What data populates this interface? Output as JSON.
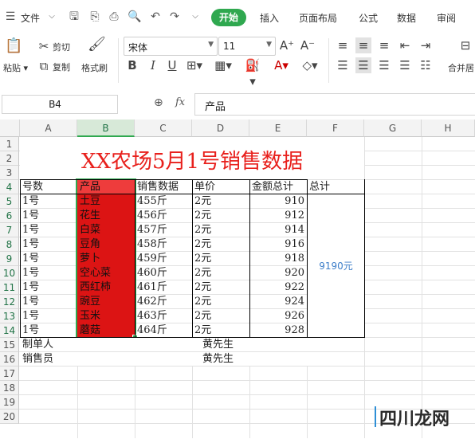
{
  "menu": {
    "file": "文件",
    "tabs": [
      {
        "label": "开始",
        "active": true
      },
      {
        "label": "插入"
      },
      {
        "label": "页面布局"
      },
      {
        "label": "公式"
      },
      {
        "label": "数据"
      },
      {
        "label": "审阅"
      }
    ]
  },
  "ribbon": {
    "paste": "粘贴",
    "cut": "剪切",
    "copy": "复制",
    "format_painter": "格式刷",
    "font_name": "宋体",
    "font_size": "11",
    "merge": "合并居"
  },
  "formula_bar": {
    "cell_ref": "B4",
    "fx": "fx",
    "content": "产品"
  },
  "columns": [
    "A",
    "B",
    "C",
    "D",
    "E",
    "F",
    "G",
    "H"
  ],
  "rows": [
    "1",
    "2",
    "3",
    "4",
    "5",
    "6",
    "7",
    "8",
    "9",
    "10",
    "11",
    "12",
    "13",
    "14",
    "15",
    "16",
    "17",
    "18",
    "19",
    "20"
  ],
  "sheet": {
    "title": "XX农场5月1号销售数据",
    "headers": [
      "号数",
      "产品",
      "销售数据",
      "单价",
      "金额总计",
      "总计"
    ],
    "data": [
      [
        "1号",
        "土豆",
        "455斤",
        "2元",
        "910"
      ],
      [
        "1号",
        "花生",
        "456斤",
        "2元",
        "912"
      ],
      [
        "1号",
        "白菜",
        "457斤",
        "2元",
        "914"
      ],
      [
        "1号",
        "豆角",
        "458斤",
        "2元",
        "916"
      ],
      [
        "1号",
        "萝卜",
        "459斤",
        "2元",
        "918"
      ],
      [
        "1号",
        "空心菜",
        "460斤",
        "2元",
        "920"
      ],
      [
        "1号",
        "西红柿",
        "461斤",
        "2元",
        "922"
      ],
      [
        "1号",
        "豌豆",
        "462斤",
        "2元",
        "924"
      ],
      [
        "1号",
        "玉米",
        "463斤",
        "2元",
        "926"
      ],
      [
        "1号",
        "蘑菇",
        "464斤",
        "2元",
        "928"
      ]
    ],
    "total": "9190元",
    "maker_label": "制单人",
    "maker_name": "黄先生",
    "seller_label": "销售员",
    "seller_name": "黄先生"
  },
  "watermark": "四川龙网",
  "colors": {
    "accent": "#2fa84f",
    "title_red": "#e8201c",
    "selection_fill": "#dc1414",
    "total_blue": "#3d7ec9"
  }
}
